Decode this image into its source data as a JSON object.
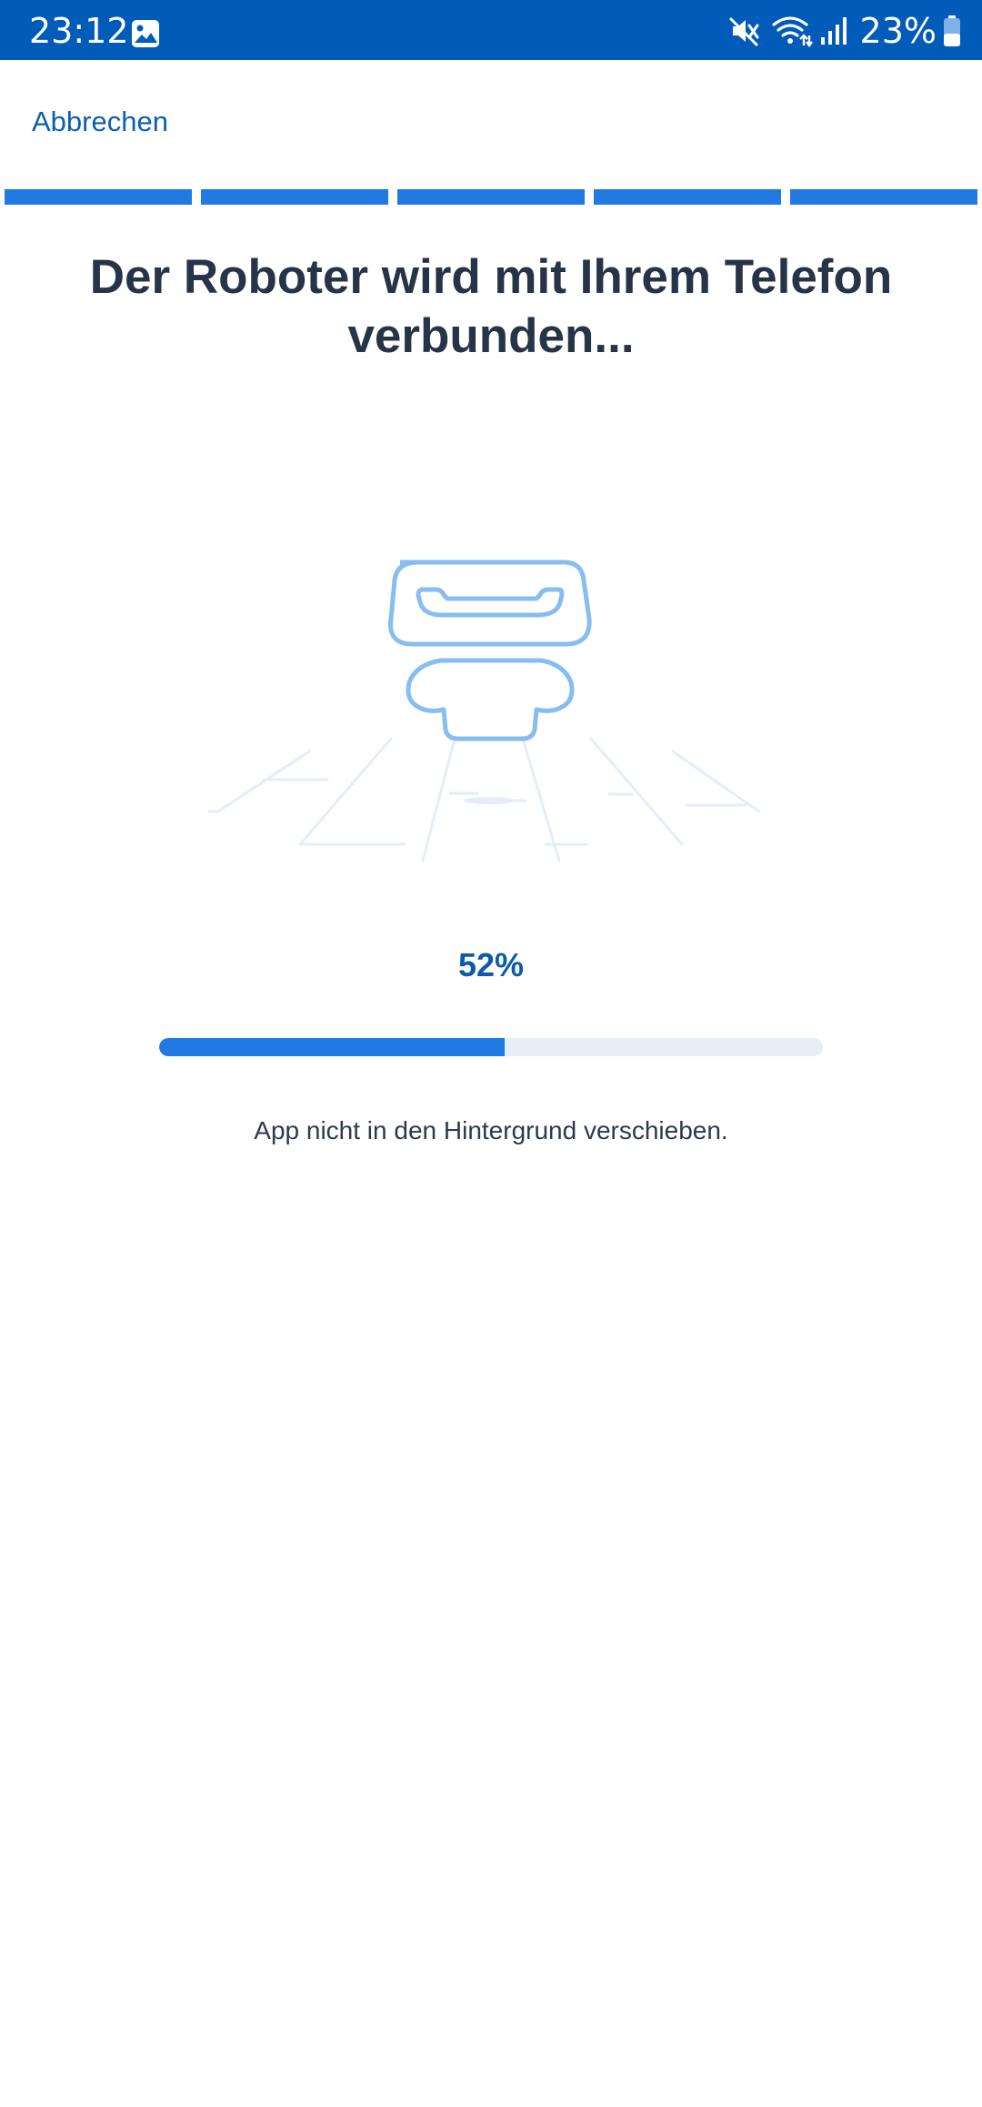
{
  "status_bar": {
    "time": "23:12",
    "battery": "23%",
    "icons": [
      "gallery-icon",
      "mute-icon",
      "wifi-icon",
      "signal-icon",
      "battery-icon"
    ]
  },
  "header": {
    "cancel_label": "Abbrechen"
  },
  "steps": {
    "total": 5,
    "completed": 5
  },
  "main": {
    "title": "Der Roboter wird mit Ihrem Telefon verbunden...",
    "illustration": "robot-connecting-icon",
    "progress_text": "52%",
    "progress_value": 0.52,
    "hint": "App nicht in den Hintergrund verschieben."
  },
  "colors": {
    "status_bar": "#015bb8",
    "accent": "#2179e2",
    "link": "#0c5fb0",
    "title": "#253447",
    "progress_track": "#e6eef8"
  }
}
